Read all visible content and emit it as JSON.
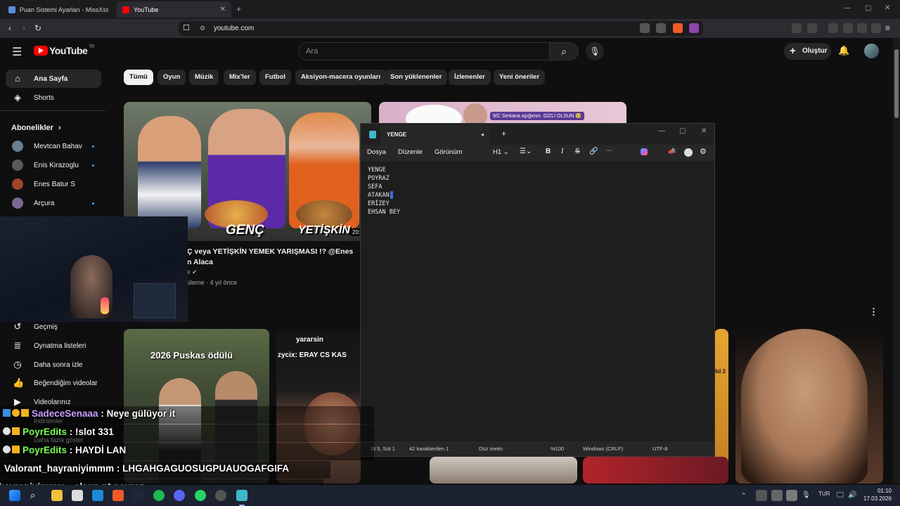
{
  "browser": {
    "tabs": [
      {
        "label": "Puan Sistemi Ayarları - MissXss AI B...",
        "active": false
      },
      {
        "label": "YouTube",
        "active": true
      }
    ],
    "url": "youtube.com"
  },
  "youtube": {
    "logo_text": "YouTube",
    "logo_region": "TR",
    "search_placeholder": "Ara",
    "create_label": "Oluştur",
    "sidebar": {
      "home": "Ana Sayfa",
      "shorts": "Shorts",
      "subscriptions_header": "Abonelikler",
      "subscriptions": [
        "Mevtcan Bahav",
        "Enis Kirazoglu",
        "Enes Batur S",
        "Arçura"
      ],
      "you_items": [
        "Geçmiş",
        "Oynatma listeleri",
        "Daha sonra izle",
        "Beğendiğim videolar",
        "Videolarınız",
        "İndirilenler",
        "Daha fazla göster"
      ]
    },
    "chips": [
      "Tümü",
      "Oyun",
      "Müzik",
      "Mix'ler",
      "Futbol",
      "Aksiyon-macera oyunları",
      "Son yüklenenler",
      "İzlenenler",
      "Yeni öneriler"
    ],
    "video1": {
      "thumb_text_1": "GENÇ",
      "thumb_text_2": "YETİŞKİN",
      "title_line1": "Ç veya YETİŞKİN YEMEK YARIŞMASI !? @Enes",
      "title_line2": "n Alaca",
      "meta": "üleme · 4 yıl önce",
      "duration": "20:"
    },
    "video2_badge": "9/C Serkana aşığımm. GİZLİ OLSUN 🥹",
    "short1_title": "2026 Puskas ödülü",
    "short2_text1": "yararsin",
    "short2_text2": "zycix: ERAY CS KAS",
    "short3_text": "4d 2"
  },
  "notepad": {
    "tab_title": "YENGE",
    "menu": [
      "Dosya",
      "Düzenle",
      "Görünüm"
    ],
    "heading_select": "H1",
    "lines": [
      "YENGE",
      "POYRAZ",
      "SEFA",
      "ATAKAN",
      "ERİZEY",
      "EHSAN BEY"
    ],
    "status": {
      "position": "St 5, Süt 1",
      "chars": "42 karakterden 1",
      "format": "Düz metin",
      "zoom": "%100",
      "line_ending": "Windows (CRLF)",
      "encoding": "UTF-8"
    }
  },
  "chat": [
    {
      "user": "SadeceSenaaa",
      "message": ": Neye gülüyor it",
      "color": "#c9a0ff"
    },
    {
      "user": "PoyrEdits",
      "message": ": !slot 331",
      "color": "#7dff5a"
    },
    {
      "user": "PoyrEdits",
      "message": ": HAYDİ LAN",
      "color": "#7dff5a"
    },
    {
      "user": "Valorant_hayraniyimmm",
      "message": ": LHGAHGAGUOSUGPUAUOGAFGIFA",
      "color": "#ffffff"
    },
    {
      "user": "hayraniyimmm",
      "message": ": olsun nt poyraz",
      "color": "#ffffff"
    }
  ],
  "taskbar": {
    "lang": "TUR",
    "time": "01:10",
    "date": "17.03.2026"
  }
}
